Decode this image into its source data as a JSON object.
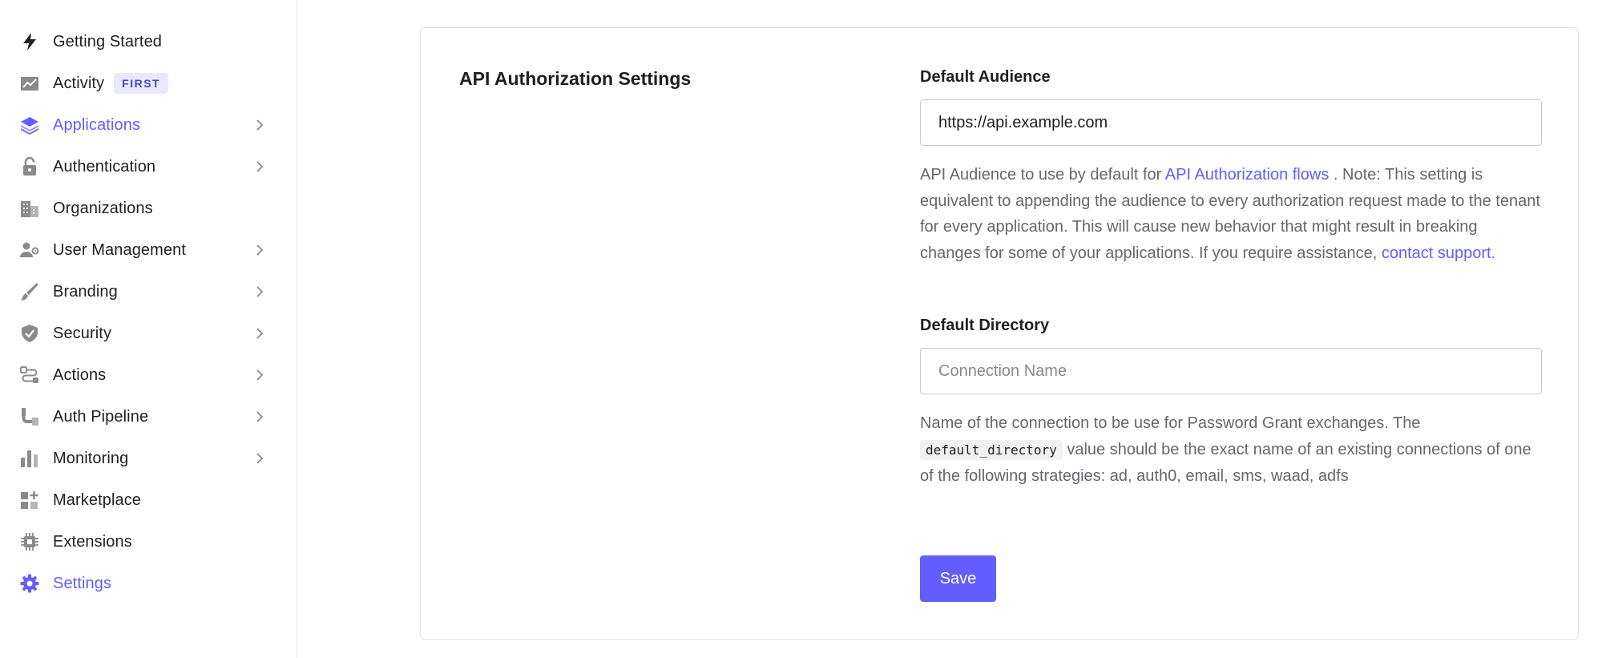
{
  "colors": {
    "accent": "#635dff",
    "text": "#1f1f1f",
    "muted": "#65676e",
    "icon": "#8a8a8e",
    "border": "#e3e3e3"
  },
  "sidebar": {
    "items": [
      {
        "label": "Getting Started",
        "icon": "lightning-icon",
        "has_chevron": false,
        "active": false
      },
      {
        "label": "Activity",
        "icon": "activity-chart-icon",
        "badge": "FIRST",
        "has_chevron": false,
        "active": false
      },
      {
        "label": "Applications",
        "icon": "layers-icon",
        "has_chevron": true,
        "active": true
      },
      {
        "label": "Authentication",
        "icon": "lock-icon",
        "has_chevron": true,
        "active": false
      },
      {
        "label": "Organizations",
        "icon": "building-icon",
        "has_chevron": false,
        "active": false
      },
      {
        "label": "User Management",
        "icon": "user-gear-icon",
        "has_chevron": true,
        "active": false
      },
      {
        "label": "Branding",
        "icon": "brush-icon",
        "has_chevron": true,
        "active": false
      },
      {
        "label": "Security",
        "icon": "shield-icon",
        "has_chevron": true,
        "active": false
      },
      {
        "label": "Actions",
        "icon": "flow-icon",
        "has_chevron": true,
        "active": false
      },
      {
        "label": "Auth Pipeline",
        "icon": "pipe-icon",
        "has_chevron": true,
        "active": false
      },
      {
        "label": "Monitoring",
        "icon": "bar-chart-icon",
        "has_chevron": true,
        "active": false
      },
      {
        "label": "Marketplace",
        "icon": "grid-plus-icon",
        "has_chevron": false,
        "active": false
      },
      {
        "label": "Extensions",
        "icon": "chip-icon",
        "has_chevron": false,
        "active": false
      },
      {
        "label": "Settings",
        "icon": "gear-icon",
        "has_chevron": false,
        "active": true
      }
    ]
  },
  "main": {
    "section_title": "API Authorization Settings",
    "default_audience": {
      "label": "Default Audience",
      "value": "https://api.example.com",
      "help_before_link": "API Audience to use by default for ",
      "help_link": "API Authorization flows",
      "help_after_link": " . Note: This setting is equivalent to appending the audience to every authorization request made to the tenant for every application. This will cause new behavior that might result in breaking changes for some of your applications. If you require assistance, ",
      "help_link2": "contact support."
    },
    "default_directory": {
      "label": "Default Directory",
      "value": "",
      "placeholder": "Connection Name",
      "help_before_code": "Name of the connection to be use for Password Grant exchanges. The ",
      "help_code": "default_directory",
      "help_after_code": " value should be the exact name of an existing connections of one of the following strategies: ad, auth0, email, sms, waad, adfs"
    },
    "save_label": "Save"
  }
}
